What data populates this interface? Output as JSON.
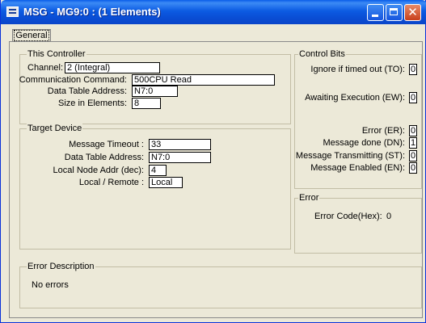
{
  "window": {
    "title": "MSG - MG9:0 : (1 Elements)"
  },
  "tabs": [
    {
      "label": "General"
    }
  ],
  "this_controller": {
    "legend": "This Controller",
    "fields": [
      {
        "label": "Channel:",
        "value": "2 (Integral)"
      },
      {
        "label": "Communication Command:",
        "value": "500CPU Read"
      },
      {
        "label": "Data Table Address:",
        "value": "N7:0"
      },
      {
        "label": "Size in Elements:",
        "value": "8"
      }
    ]
  },
  "target_device": {
    "legend": "Target Device",
    "fields": [
      {
        "label": "Message Timeout :",
        "value": "33"
      },
      {
        "label": "Data Table Address:",
        "value": "N7:0"
      },
      {
        "label": "Local Node Addr (dec):",
        "value": "4"
      },
      {
        "label": "Local / Remote :",
        "value": "Local"
      }
    ]
  },
  "control_bits": {
    "legend": "Control Bits",
    "bits": [
      {
        "label": "Ignore if timed out (TO):",
        "value": "0"
      },
      {
        "label": "Awaiting Execution (EW):",
        "value": "0"
      },
      {
        "label": "Error (ER):",
        "value": "0"
      },
      {
        "label": "Message done (DN):",
        "value": "1"
      },
      {
        "label": "Message Transmitting (ST):",
        "value": "0"
      },
      {
        "label": "Message Enabled (EN):",
        "value": "0"
      }
    ]
  },
  "error": {
    "legend": "Error",
    "code_label": "Error Code(Hex):",
    "code_value": "0"
  },
  "error_description": {
    "legend": "Error Description",
    "text": "No errors"
  },
  "colors": {
    "titlebar": "#0a4fd6",
    "face": "#ece9d8",
    "close_button": "#c8401c"
  },
  "icons": {
    "app": "msg-app-icon",
    "minimize": "minimize-icon",
    "maximize": "maximize-icon",
    "close": "close-icon"
  }
}
